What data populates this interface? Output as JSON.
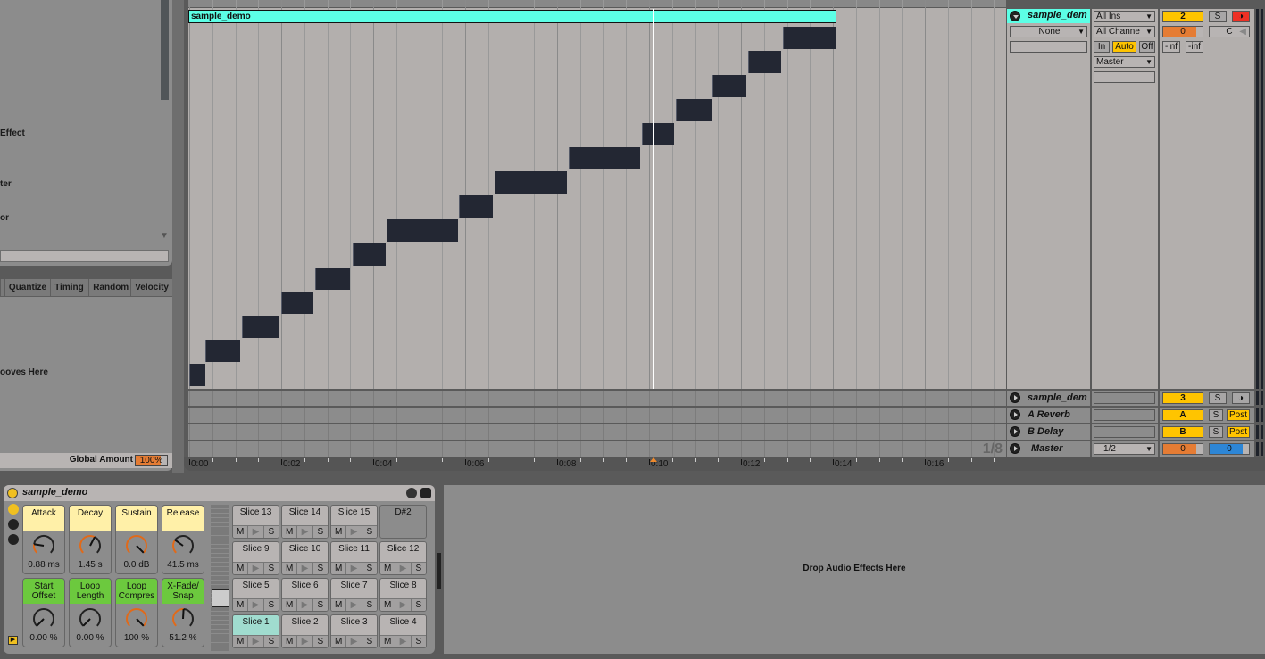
{
  "browser": {
    "items": [
      {
        "label": "Effect"
      },
      {
        "label": "ter"
      },
      {
        "label": "or"
      }
    ]
  },
  "groove_pool": {
    "columns": [
      "Quantize",
      "Timing",
      "Random",
      "Velocity"
    ],
    "drop_hint": "ooves Here",
    "global_amount_label": "Global Amount",
    "global_amount_value": "100%",
    "global_amount_fraction": 1.0
  },
  "clip": {
    "name": "sample_demo",
    "color": "#5cffe6",
    "notes": [
      {
        "start": 0.0,
        "end": 0.35,
        "pitch": 0
      },
      {
        "start": 0.35,
        "end": 1.1,
        "pitch": 1
      },
      {
        "start": 1.15,
        "end": 1.95,
        "pitch": 2
      },
      {
        "start": 2.0,
        "end": 2.7,
        "pitch": 3
      },
      {
        "start": 2.73,
        "end": 3.5,
        "pitch": 4
      },
      {
        "start": 3.55,
        "end": 4.27,
        "pitch": 5
      },
      {
        "start": 4.3,
        "end": 5.85,
        "pitch": 6
      },
      {
        "start": 5.87,
        "end": 6.6,
        "pitch": 7
      },
      {
        "start": 6.65,
        "end": 8.22,
        "pitch": 8
      },
      {
        "start": 8.26,
        "end": 9.8,
        "pitch": 9
      },
      {
        "start": 9.84,
        "end": 10.54,
        "pitch": 10
      },
      {
        "start": 10.58,
        "end": 11.36,
        "pitch": 11
      },
      {
        "start": 11.38,
        "end": 12.12,
        "pitch": 12
      },
      {
        "start": 12.16,
        "end": 12.88,
        "pitch": 13
      },
      {
        "start": 12.92,
        "end": 14.08,
        "pitch": 14
      }
    ],
    "clip_end": 14.08,
    "playhead": 10.1
  },
  "ruler": {
    "labels": [
      "0:00",
      "0:02",
      "0:04",
      "0:06",
      "0:08",
      "0:10",
      "0:12",
      "0:14",
      "0:16"
    ],
    "quantization": "1/8"
  },
  "tracks": {
    "main": {
      "name": "sample_dem",
      "input_type": "None",
      "input_channel_type": "All Ins",
      "input_channel": "All Channe",
      "monitor": [
        "In",
        "Auto",
        "Off"
      ],
      "monitor_active": "Auto",
      "output": "Master",
      "number": "2",
      "solo": "S",
      "volume": "0",
      "volume_fraction": 0.85,
      "pan": "C",
      "peak_l": "-inf",
      "peak_r": "-inf"
    },
    "rows": [
      {
        "name": "sample_dem",
        "badge": "3",
        "solo": "S",
        "extra": "arm"
      },
      {
        "name": "A Reverb",
        "badge": "A",
        "solo": "S",
        "extra": "Post"
      },
      {
        "name": "B Delay",
        "badge": "B",
        "solo": "S",
        "extra": "Post"
      },
      {
        "name": "Master",
        "output": "1/2",
        "volume": "0",
        "volume_fraction": 0.85,
        "cue": "0",
        "cue_fraction": 0.85
      }
    ]
  },
  "device": {
    "title": "sample_demo",
    "knobs_top": [
      {
        "label": "Attack",
        "value": "0.88 ms",
        "amount": 0.2
      },
      {
        "label": "Decay",
        "value": "1.45 s",
        "amount": 0.6
      },
      {
        "label": "Sustain",
        "value": "0.0 dB",
        "amount": 1.0
      },
      {
        "label": "Release",
        "value": "41.5 ms",
        "amount": 0.3
      }
    ],
    "knobs_bottom": [
      {
        "label": "Start Offset",
        "value": "0.00 %",
        "amount": 0.0
      },
      {
        "label": "Loop Length",
        "value": "0.00 %",
        "amount": 0.0
      },
      {
        "label": "Loop Compres",
        "value": "100 %",
        "amount": 1.0
      },
      {
        "label": "X-Fade/ Snap",
        "value": "51.2 %",
        "amount": 0.512
      }
    ],
    "pads": [
      [
        "Slice 13",
        "Slice 14",
        "Slice 15",
        "D#2"
      ],
      [
        "Slice 9",
        "Slice 10",
        "Slice 11",
        "Slice 12"
      ],
      [
        "Slice 5",
        "Slice 6",
        "Slice 7",
        "Slice 8"
      ],
      [
        "Slice 1",
        "Slice 2",
        "Slice 3",
        "Slice 4"
      ]
    ],
    "selected_pad": "Slice 1",
    "pad_controls": [
      "M",
      "▶",
      "S"
    ]
  },
  "fx_drop": "Drop Audio Effects Here"
}
